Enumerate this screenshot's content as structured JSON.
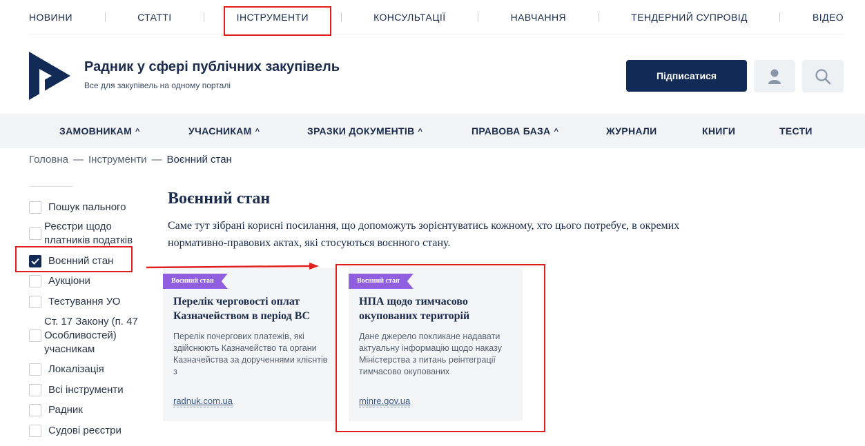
{
  "topnav": [
    {
      "label": "НОВИНИ"
    },
    {
      "label": "СТАТТІ"
    },
    {
      "label": "ІНСТРУМЕНТИ"
    },
    {
      "label": "КОНСУЛЬТАЦІЇ"
    },
    {
      "label": "НАВЧАННЯ"
    },
    {
      "label": "ТЕНДЕРНИЙ СУПРОВІД"
    },
    {
      "label": "ВІДЕО"
    }
  ],
  "brand": {
    "title": "Радник у сфері публічних закупівель",
    "subtitle": "Все для закупівель на одному порталі",
    "subscribe_label": "Підписатися"
  },
  "mainnav": [
    {
      "label": "ЗАМОВНИКАМ",
      "chevron": "^"
    },
    {
      "label": "УЧАСНИКАМ",
      "chevron": "^"
    },
    {
      "label": "ЗРАЗКИ ДОКУМЕНТІВ",
      "chevron": "^"
    },
    {
      "label": "ПРАВОВА БАЗА",
      "chevron": "^"
    },
    {
      "label": "ЖУРНАЛИ"
    },
    {
      "label": "КНИГИ"
    },
    {
      "label": "ТЕСТИ"
    }
  ],
  "breadcrumb": {
    "home": "Головна",
    "section": "Інструменти",
    "current": "Воєнний стан",
    "separator": "—"
  },
  "filters": [
    {
      "label": "Пошук пального",
      "checked": false
    },
    {
      "label": "Реєстри щодо платників податків",
      "checked": false
    },
    {
      "label": "Воєнний стан",
      "checked": true
    },
    {
      "label": "Аукціони",
      "checked": false
    },
    {
      "label": "Тестування УО",
      "checked": false
    },
    {
      "label": "Ст. 17 Закону (п. 47 Особливостей) учасникам",
      "checked": false
    },
    {
      "label": "Локалізація",
      "checked": false
    },
    {
      "label": "Всі інструменти",
      "checked": false
    },
    {
      "label": "Радник",
      "checked": false
    },
    {
      "label": "Судові реєстри",
      "checked": false
    }
  ],
  "content": {
    "title": "Воєнний стан",
    "intro": "Саме тут зібрані корисні посилання, що допоможуть зорієнтуватись кожному, хто цього потребує, в окремих нормативно-правових актах, які стосуються воєнного стану."
  },
  "cards": [
    {
      "tag": "Воєнний стан",
      "title": "Перелік черговості оплат Казначейством в період ВС",
      "desc": "Перелік почергових платежів, які здійснюють Казначейство та органи Казначейства за дорученнями клієнтів з",
      "link": "radnuk.com.ua"
    },
    {
      "tag": "Воєнний стан",
      "title": "НПА щодо тимчасово окупованих територій",
      "desc": "Дане джерело покликане надавати актуальну інформацію щодо наказу Міністерства з питань реінтеграції тимчасово окупованих",
      "link": "minre.gov.ua"
    }
  ],
  "icons": {
    "logo": "radnyk-logo",
    "user": "user-icon",
    "search": "search-icon",
    "check": "check-icon"
  },
  "colors": {
    "brand_navy": "#122a56",
    "text": "#1b2b4b",
    "tag_purple": "#8f5fe0",
    "annotation_red": "#e11d1d",
    "nav_bg": "#f1f3f4",
    "card_bg": "#f4f5f6"
  }
}
